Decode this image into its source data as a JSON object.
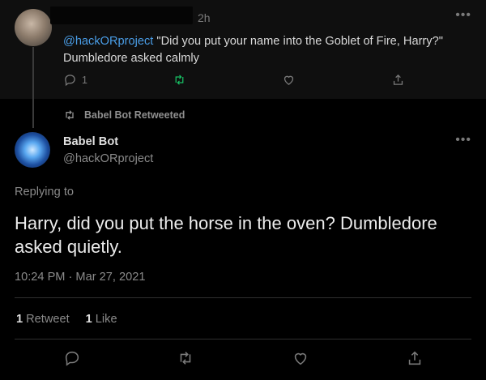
{
  "parent_tweet": {
    "time": "2h",
    "mention": "@hackORproject",
    "text": " \"Did you put your name into the Goblet of Fire, Harry?\" Dumbledore asked calmly",
    "reply_count": "1"
  },
  "retweet_banner": {
    "label": "Babel Bot Retweeted"
  },
  "main_tweet": {
    "name": "Babel Bot",
    "handle": "@hackORproject",
    "replying_to": "Replying to",
    "text": "Harry, did you put the horse in the oven? Dumbledore asked quietly.",
    "timestamp": "10:24 PM · Mar 27, 2021"
  },
  "stats": {
    "retweets_count": "1",
    "retweets_label": "Retweet",
    "likes_count": "1",
    "likes_label": "Like"
  },
  "icons": [
    "reply-icon",
    "retweet-icon",
    "like-icon",
    "share-icon",
    "more-icon"
  ],
  "colors": {
    "background": "#000000",
    "mention": "#4a9ee8",
    "retweet_green": "#17bf63",
    "muted": "#8a8a8a"
  }
}
